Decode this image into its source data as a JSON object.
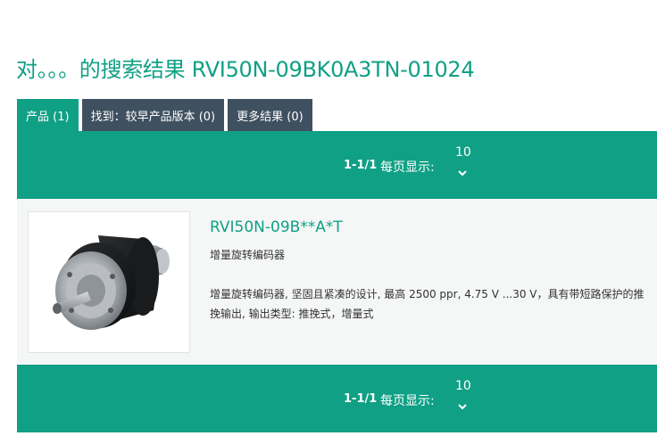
{
  "page": {
    "title": "对。。。的搜索结果 RVI50N-09BK0A3TN-01024"
  },
  "tabs": [
    {
      "label": "产品 (1)",
      "active": true
    },
    {
      "label": "找到：较早产品版本 (0)",
      "active": false
    },
    {
      "label": "更多结果 (0)",
      "active": false
    }
  ],
  "pager": {
    "count": "1-1/1",
    "per_page_label": "每页显示:",
    "per_page_value": "10",
    "chevron_icon": "chevron-down-icon"
  },
  "result": {
    "title": "RVI50N-09B**A*T",
    "subtitle": "增量旋转编码器",
    "description": "增量旋转编码器, 坚固且紧凑的设计, 最高 2500 ppr, 4.75 V ...30 V，具有带短路保护的推挽输出, 输出类型: 推挽式，增量式",
    "image_icon": "rotary-encoder-image"
  },
  "colors": {
    "accent": "#10a085",
    "tab_inactive": "#3f5060",
    "row_bg": "#f5f6f6"
  }
}
